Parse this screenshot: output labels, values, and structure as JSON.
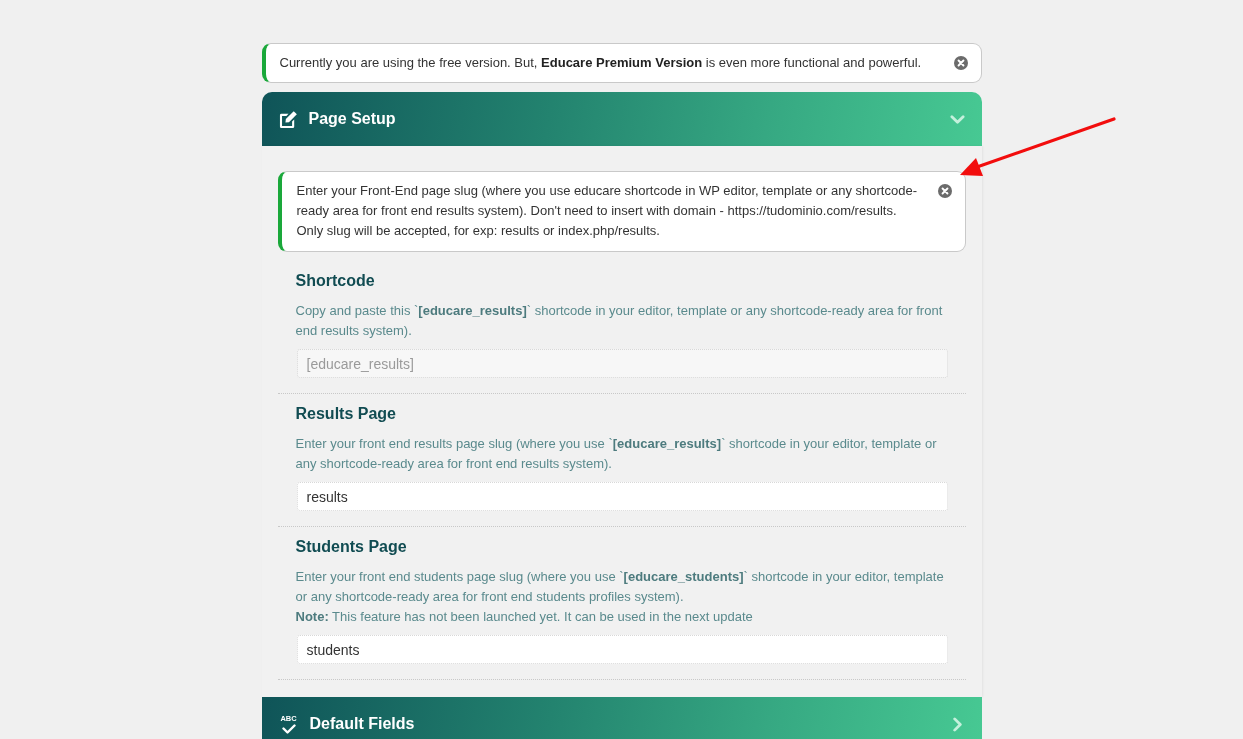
{
  "notice": {
    "text": "Currently you are using the free version. But, **Educare Premium Version** is even more functional and powerful."
  },
  "panels": [
    {
      "title": "Page Setup",
      "expanded": true,
      "notice": "Enter your Front-End page slug (where you use educare shortcode in WP editor, template or any shortcode-ready area for front end results system). Don't need to insert with domain - https://tudominio.com/results. Only slug will be accepted, for exp: results or index.php/results.",
      "fields": [
        {
          "label": "Shortcode",
          "description": [
            "Copy and paste this `**[educare_results]**` shortcode in your editor, template or any shortcode-ready area for front end results system)."
          ],
          "value": "[educare_results]",
          "disabled": true
        },
        {
          "label": "Results Page",
          "description": [
            "Enter your front end results page slug (where you use `**[educare_results]**` shortcode in your editor, template or any shortcode-ready area for front end results system)."
          ],
          "value": "results",
          "disabled": false
        },
        {
          "label": "Students Page",
          "description": [
            "Enter your front end students page slug (where you use `**[educare_students]**` shortcode in your editor, template or any shortcode-ready area for front end students profiles system).",
            "**Note:** This feature has not been launched yet. It can be used in the next update"
          ],
          "value": "students",
          "disabled": false
        }
      ]
    },
    {
      "title": "Default Fields",
      "icon_text": "ABC",
      "expanded": false
    }
  ]
}
